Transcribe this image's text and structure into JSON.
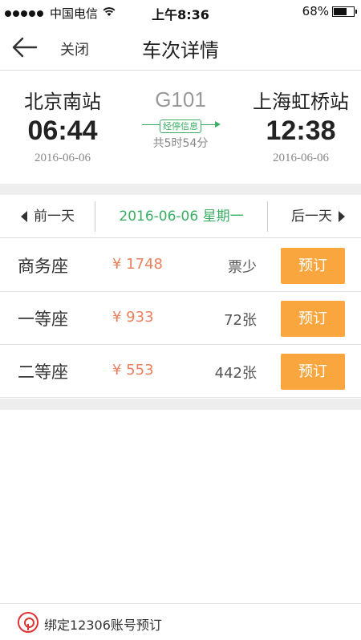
{
  "status_bar": {
    "carrier": "中国电信",
    "time": "上午8:36",
    "battery": "68%",
    "battery_level": 0.68
  },
  "nav": {
    "back_icon": "arrow-left-icon",
    "close_label": "关闭",
    "title": "车次详情"
  },
  "train": {
    "code": "G101",
    "stops_label": "经停信息",
    "duration": "共5时54分",
    "from": {
      "station": "北京南站",
      "time": "06:44",
      "date": "2016-06-06"
    },
    "to": {
      "station": "上海虹桥站",
      "time": "12:38",
      "date": "2016-06-06"
    }
  },
  "date_switch": {
    "prev_label": "前一天",
    "current": "2016-06-06 星期一",
    "next_label": "后一天"
  },
  "seats": [
    {
      "type": "商务座",
      "price": "¥ 1748",
      "remaining": "票少",
      "book_label": "预订"
    },
    {
      "type": "一等座",
      "price": "¥ 933",
      "remaining": "72张",
      "book_label": "预订"
    },
    {
      "type": "二等座",
      "price": "¥ 553",
      "remaining": "442张",
      "book_label": "预订"
    }
  ],
  "bottom": {
    "logo_icon": "railway-logo-icon",
    "label": "绑定12306账号预订"
  },
  "colors": {
    "green": "#3aae64",
    "orange_button": "#f9a63f",
    "price": "#e9815f"
  }
}
